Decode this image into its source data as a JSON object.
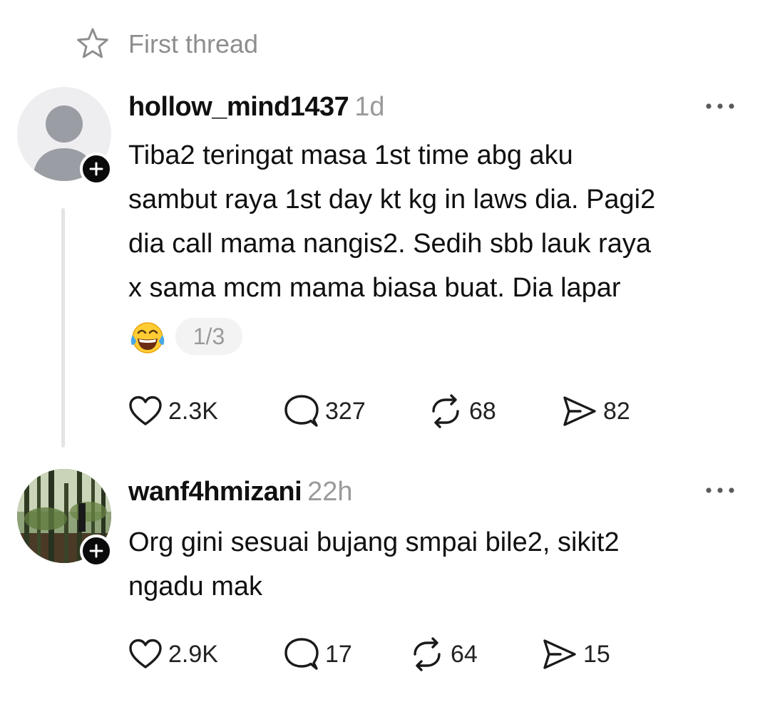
{
  "header": {
    "title": "First thread",
    "icon": "star-icon"
  },
  "posts": [
    {
      "username": "hollow_mind1437",
      "time": "1d",
      "body_lines": [
        "Tiba2 teringat masa 1st time abg aku",
        "sambut raya 1st day kt kg in laws dia. Pagi2",
        "dia call mama nangis2. Sedih sbb lauk raya",
        "x sama mcm mama biasa buat. Dia lapar"
      ],
      "emoji": "face-with-tears-of-joy",
      "page_indicator": "1/3",
      "likes": "2.3K",
      "replies": "327",
      "reposts": "68",
      "shares": "82"
    },
    {
      "username": "wanf4hmizani",
      "time": "22h",
      "body_lines": [
        "Org gini sesuai bujang smpai bile2, sikit2",
        "ngadu mak"
      ],
      "likes": "2.9K",
      "replies": "17",
      "reposts": "64",
      "shares": "15"
    }
  ],
  "colors": {
    "text": "#101010",
    "muted": "#9a9a9a",
    "thread_line": "#e4e4e4",
    "badge": "#0b0b0b"
  }
}
